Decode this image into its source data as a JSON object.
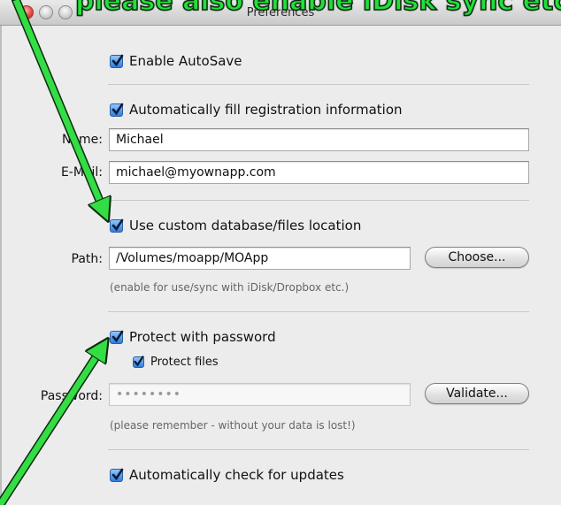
{
  "window": {
    "title": "Preferences",
    "overlay_banner": "please also enable iDisk sync etc."
  },
  "autosave": {
    "label": "Enable AutoSave",
    "checked": true
  },
  "registration": {
    "label": "Automatically fill registration information",
    "checked": true,
    "name_label": "Name:",
    "name_value": "Michael",
    "email_label": "E-Mail:",
    "email_value": "michael@myownapp.com"
  },
  "database": {
    "label": "Use custom database/files location",
    "checked": true,
    "path_label": "Path:",
    "path_value": "/Volumes/moapp/MOApp",
    "choose_button": "Choose...",
    "hint": "(enable for use/sync with iDisk/Dropbox etc.)"
  },
  "password": {
    "label": "Protect with password",
    "checked": true,
    "protect_files_label": "Protect files",
    "protect_files_checked": true,
    "password_label": "Password:",
    "password_value": "••••••••",
    "validate_button": "Validate...",
    "hint": "(please remember - without your data is lost!)"
  },
  "updates": {
    "label": "Automatically check for updates",
    "checked": true
  },
  "colors": {
    "accent": "#2f7ce0",
    "annotation_arrow": "#33dd44"
  }
}
